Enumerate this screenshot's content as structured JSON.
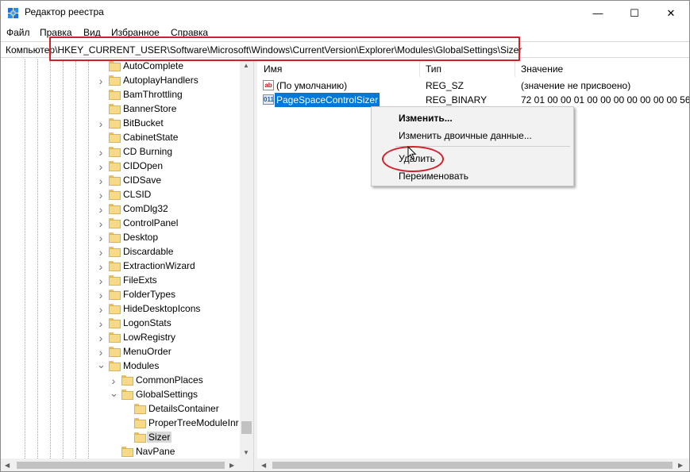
{
  "window": {
    "title": "Редактор реестра",
    "controls": {
      "minimize": "—",
      "maximize": "☐",
      "close": "✕"
    }
  },
  "menu": [
    "Файл",
    "Правка",
    "Вид",
    "Избранное",
    "Справка"
  ],
  "address": "Компьютер\\HKEY_CURRENT_USER\\Software\\Microsoft\\Windows\\CurrentVersion\\Explorer\\Modules\\GlobalSettings\\Sizer",
  "tree": {
    "items": [
      {
        "label": "AutoComplete",
        "expander": "none"
      },
      {
        "label": "AutoplayHandlers",
        "expander": "collapsed"
      },
      {
        "label": "BamThrottling",
        "expander": "none"
      },
      {
        "label": "BannerStore",
        "expander": "none"
      },
      {
        "label": "BitBucket",
        "expander": "collapsed"
      },
      {
        "label": "CabinetState",
        "expander": "none"
      },
      {
        "label": "CD Burning",
        "expander": "collapsed"
      },
      {
        "label": "CIDOpen",
        "expander": "collapsed"
      },
      {
        "label": "CIDSave",
        "expander": "collapsed"
      },
      {
        "label": "CLSID",
        "expander": "collapsed"
      },
      {
        "label": "ComDlg32",
        "expander": "collapsed"
      },
      {
        "label": "ControlPanel",
        "expander": "collapsed"
      },
      {
        "label": "Desktop",
        "expander": "collapsed"
      },
      {
        "label": "Discardable",
        "expander": "collapsed"
      },
      {
        "label": "ExtractionWizard",
        "expander": "collapsed"
      },
      {
        "label": "FileExts",
        "expander": "collapsed"
      },
      {
        "label": "FolderTypes",
        "expander": "collapsed"
      },
      {
        "label": "HideDesktopIcons",
        "expander": "collapsed"
      },
      {
        "label": "LogonStats",
        "expander": "collapsed"
      },
      {
        "label": "LowRegistry",
        "expander": "collapsed"
      },
      {
        "label": "MenuOrder",
        "expander": "collapsed"
      },
      {
        "label": "Modules",
        "expander": "expanded"
      },
      {
        "label": "CommonPlaces",
        "expander": "collapsed"
      },
      {
        "label": "GlobalSettings",
        "expander": "expanded"
      },
      {
        "label": "DetailsContainer",
        "expander": "none"
      },
      {
        "label": "ProperTreeModuleInr",
        "expander": "none"
      },
      {
        "label": "Sizer",
        "expander": "none",
        "selected": true
      },
      {
        "label": "NavPane",
        "expander": "none"
      }
    ]
  },
  "list": {
    "columns": [
      "Имя",
      "Тип",
      "Значение"
    ],
    "rows": [
      {
        "icon": "ab",
        "name": "(По умолчанию)",
        "type": "REG_SZ",
        "value": "(значение не присвоено)"
      },
      {
        "icon": "bin",
        "name": "PageSpaceControlSizer",
        "type": "REG_BINARY",
        "value": "72 01 00 00 01 00 00 00 00 00 00 00 56 05 0",
        "selected": true
      }
    ]
  },
  "context_menu": {
    "items": [
      {
        "label": "Изменить...",
        "default": true
      },
      {
        "label": "Изменить двоичные данные..."
      },
      {
        "label": "Удалить"
      },
      {
        "label": "Переименовать"
      }
    ]
  },
  "colors": {
    "selection": "#0078d7",
    "annotation_red": "#d0202a",
    "folder": "#f7d98a"
  }
}
